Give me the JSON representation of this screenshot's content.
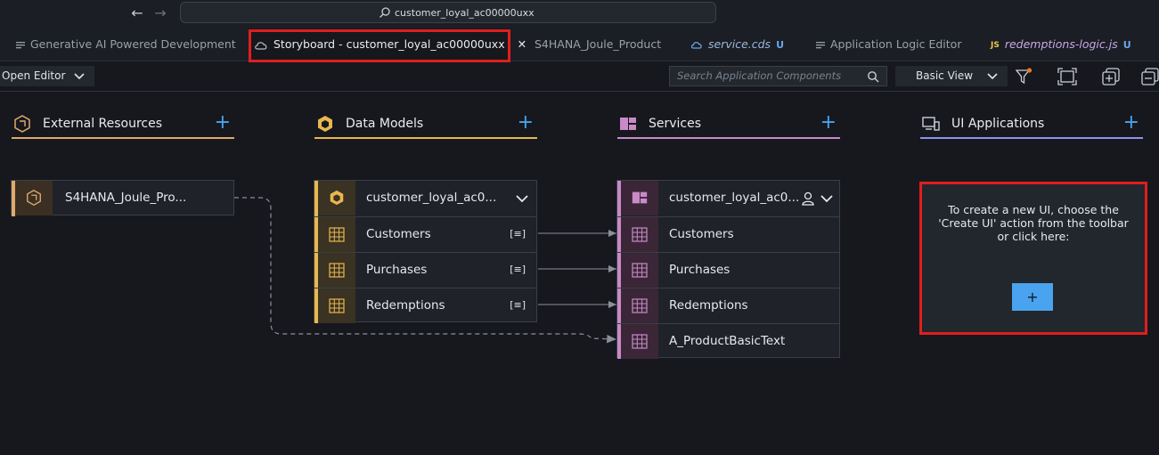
{
  "topbar": {
    "back_icon": "arrow-left-icon",
    "forward_icon": "arrow-right-icon",
    "command_center_text": "customer_loyal_ac00000uxx"
  },
  "tabs": [
    {
      "label": "Generative AI Powered Development",
      "icon": "preview-icon"
    },
    {
      "label": "Storyboard - customer_loyal_ac00000uxx",
      "icon": "cloud-icon",
      "close": "✕"
    },
    {
      "label": "S4HANA_Joule_Product",
      "icon": ""
    },
    {
      "label": "service.cds",
      "icon": "cloud-file-icon",
      "badge": "U"
    },
    {
      "label": "Application Logic Editor",
      "icon": "preview-icon"
    },
    {
      "label": "redemptions-logic.js",
      "icon": "js-icon",
      "icon_text": "JS",
      "badge": "U"
    }
  ],
  "toolbar": {
    "open_editor_label": "Open Editor",
    "search_placeholder": "Search Application Components",
    "view_label": "Basic View"
  },
  "columns": {
    "external": {
      "title": "External Resources",
      "plus": "+",
      "color": "#e0a96d"
    },
    "models": {
      "title": "Data Models",
      "plus": "+",
      "color": "#e8b84f"
    },
    "services": {
      "title": "Services",
      "plus": "+",
      "color": "#c98ac8"
    },
    "ui": {
      "title": "UI Applications",
      "plus": "+",
      "color": "#8d93f0"
    }
  },
  "external_card": {
    "title": "S4HANA_Joule_Pro..."
  },
  "models_card": {
    "title": "customer_loyal_ac0...",
    "entities": [
      "Customers",
      "Purchases",
      "Redemptions"
    ],
    "entity_marker": "[≡]"
  },
  "services_card": {
    "title": "customer_loyal_ac0...",
    "entities": [
      "Customers",
      "Purchases",
      "Redemptions",
      "A_ProductBasicText"
    ]
  },
  "ui_empty": {
    "message": "To create a new UI, choose the 'Create UI' action from the toolbar or click here:",
    "button": "+"
  }
}
